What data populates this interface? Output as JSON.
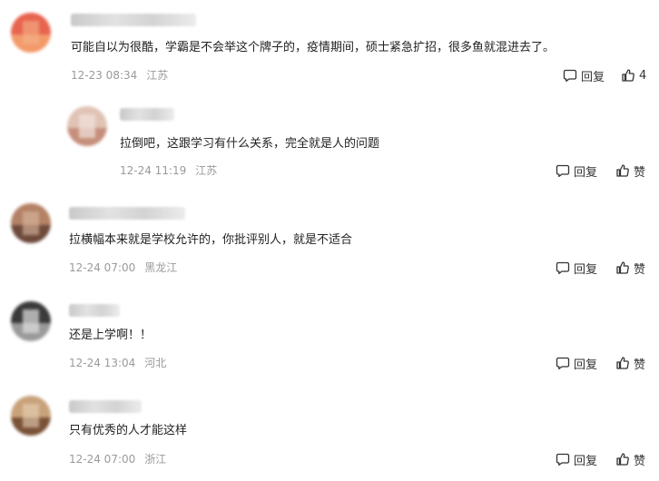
{
  "colors": {
    "text": "#222222",
    "meta": "#9a9a9a",
    "action": "#333333"
  },
  "labels": {
    "reply": "回复",
    "like": "赞"
  },
  "icons": {
    "reply": "comment-bubble-icon",
    "like": "thumbs-up-icon"
  },
  "comments": [
    {
      "text": "可能自以为很酷，学霸是不会举这个牌子的，疫情期间，硕士紧急扩招，很多鱼就混进去了。",
      "time": "12-23 08:34",
      "location": "江苏",
      "likes": "4",
      "is_reply": false
    },
    {
      "text": "拉倒吧，这跟学习有什么关系，完全就是人的问题",
      "time": "12-24 11:19",
      "location": "江苏",
      "is_reply": true
    },
    {
      "text": "拉横幅本来就是学校允许的，你批评别人，就是不适合",
      "time": "12-24 07:00",
      "location": "黑龙江",
      "is_reply": false
    },
    {
      "text": "还是上学啊！！",
      "time": "12-24 13:04",
      "location": "河北",
      "is_reply": false
    },
    {
      "text": "只有优秀的人才能这样",
      "time": "12-24 07:00",
      "location": "浙江",
      "is_reply": false
    }
  ]
}
